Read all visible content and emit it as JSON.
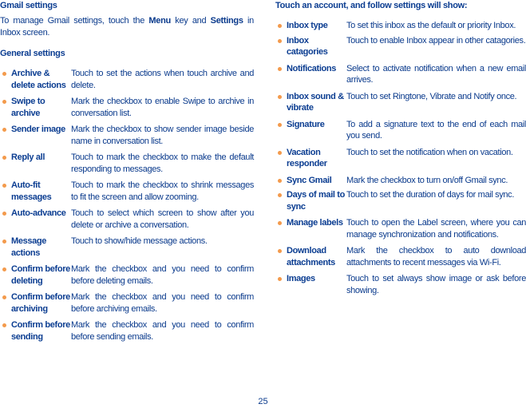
{
  "left": {
    "title": "Gmail settings",
    "intro": {
      "part1": "To manage Gmail settings, touch the ",
      "bold1": "Menu",
      "part2": " key and ",
      "bold2": "Settings",
      "part3": " in Inbox screen."
    },
    "subtitle": "General settings",
    "items": [
      {
        "term": "Archive & delete actions",
        "desc": "Touch to set the actions when touch archive and delete."
      },
      {
        "term": "Swipe to archive",
        "desc": "Mark the checkbox to enable Swipe to archive in conversation list."
      },
      {
        "term": "Sender image",
        "desc": "Mark the checkbox to show sender image beside name in conversation list."
      },
      {
        "term": "Reply all",
        "desc": "Touch to mark the checkbox to make the default responding to messages."
      },
      {
        "term": "Auto-fit messages",
        "desc": "Touch to mark the checkbox to shrink messages to fit the screen and allow zooming."
      },
      {
        "term": "Auto-advance",
        "desc": "Touch to select which screen to show after you delete or archive a conversation."
      },
      {
        "term": "Message actions",
        "desc": "Touch to show/hide message actions."
      },
      {
        "term": "Confirm before deleting",
        "desc": "Mark the checkbox and you need to confirm before deleting emails."
      },
      {
        "term": "Confirm before archiving",
        "desc": "Mark the checkbox and you need to confirm before archiving emails."
      },
      {
        "term": "Confirm before sending",
        "desc": "Mark the checkbox and you need to confirm before sending emails."
      }
    ]
  },
  "right": {
    "title": "Touch an account, and follow settings will show:",
    "items": [
      {
        "term": "Inbox type",
        "desc": "To set this inbox as the default or priority Inbox."
      },
      {
        "term": "Inbox catagories",
        "desc": "Touch to enable Inbox appear in other catagories."
      },
      {
        "term": "Notifications",
        "desc": "Select to activate notification when a new email arrives."
      },
      {
        "term": "Inbox sound & vibrate",
        "desc": "Touch to set Ringtone, Vibrate and Notify once."
      },
      {
        "term": "Signature",
        "desc": "To add a signature text to the end of each mail you send."
      },
      {
        "term": "Vacation responder",
        "desc": "Touch to set the notification when on vacation."
      },
      {
        "term": "Sync Gmail",
        "desc": "Mark the checkbox to turn on/off Gmail sync."
      },
      {
        "term": "Days of mail to sync",
        "desc": "Touch to set the duration of days for mail sync."
      },
      {
        "term": "Manage labels",
        "desc": "Touch to open the Label screen, where you can manage synchronization and notifications."
      },
      {
        "term": "Download attachments",
        "desc": "Mark the checkbox to auto download attachments to recent messages via Wi-Fi."
      },
      {
        "term": "Images",
        "desc": "Touch to set always show image or ask before showing."
      }
    ]
  },
  "page_number": "25",
  "colors": {
    "text": "#0a3a8c",
    "bullet": "#f39a4c"
  }
}
